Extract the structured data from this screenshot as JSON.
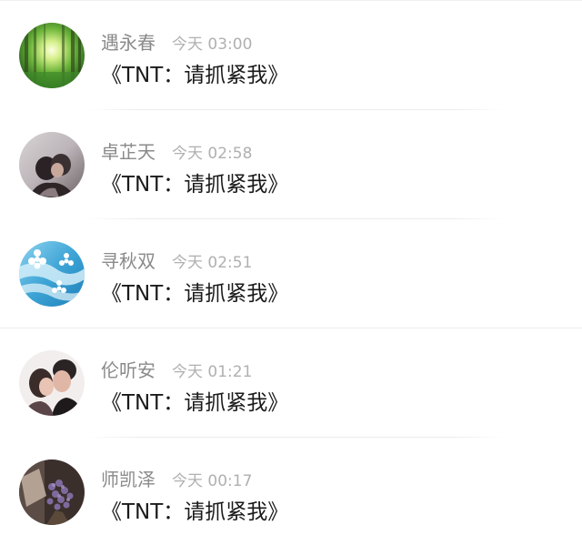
{
  "messages": [
    {
      "name": "遇永春",
      "time": "今天 03:00",
      "text": "《TNT：请抓紧我》",
      "avatar_icon": "forest-avatar"
    },
    {
      "name": "卓芷天",
      "time": "今天 02:58",
      "text": "《TNT：请抓紧我》",
      "avatar_icon": "couple-avatar"
    },
    {
      "name": "寻秋双",
      "time": "今天 02:51",
      "text": "《TNT：请抓紧我》",
      "avatar_icon": "blue-flower-avatar"
    },
    {
      "name": "伦听安",
      "time": "今天 01:21",
      "text": "《TNT：请抓紧我》",
      "avatar_icon": "kiss-avatar"
    },
    {
      "name": "师凯泽",
      "time": "今天 00:17",
      "text": "《TNT：请抓紧我》",
      "avatar_icon": "lavender-avatar"
    }
  ],
  "colors": {
    "name": "#8a8a8a",
    "time": "#b0b0b0",
    "message": "#1a1a1a",
    "divider": "#ececec"
  }
}
